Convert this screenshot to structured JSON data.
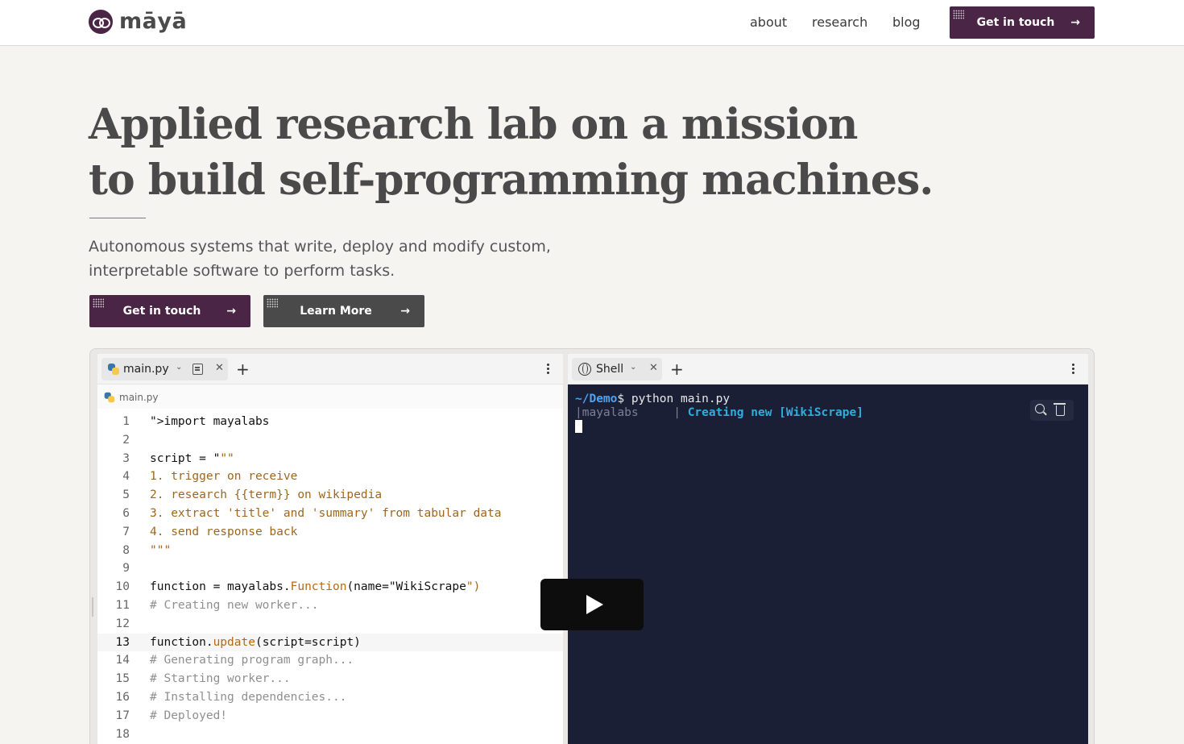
{
  "header": {
    "brand": "māyā",
    "nav": [
      "about",
      "research",
      "blog"
    ],
    "cta_label": "Get in touch"
  },
  "hero": {
    "title_line1": "Applied research lab on a mission",
    "title_line2": "to build self-programming machines.",
    "subtitle_line1": "Autonomous systems that write, deploy and modify custom,",
    "subtitle_line2": "interpretable software to perform tasks.",
    "primary_button": "Get in touch",
    "secondary_button": "Learn More"
  },
  "editor": {
    "tab_label": "main.py",
    "breadcrumb": "main.py",
    "lines": [
      {
        "n": "1",
        "text": "import mayalabs"
      },
      {
        "n": "2",
        "text": ""
      },
      {
        "n": "3",
        "text": "script = \"\"\""
      },
      {
        "n": "4",
        "text": "1. trigger on receive"
      },
      {
        "n": "5",
        "text": "2. research {{term}} on wikipedia"
      },
      {
        "n": "6",
        "text": "3. extract 'title' and 'summary' from tabular data"
      },
      {
        "n": "7",
        "text": "4. send response back"
      },
      {
        "n": "8",
        "text": "\"\"\""
      },
      {
        "n": "9",
        "text": ""
      },
      {
        "n": "10",
        "text": "function = mayalabs.Function(name=\"WikiScrape\")"
      },
      {
        "n": "11",
        "text": "# Creating new worker..."
      },
      {
        "n": "12",
        "text": ""
      },
      {
        "n": "13",
        "text": "function.update(script=script)"
      },
      {
        "n": "14",
        "text": "# Generating program graph..."
      },
      {
        "n": "15",
        "text": "# Starting worker..."
      },
      {
        "n": "16",
        "text": "# Installing dependencies..."
      },
      {
        "n": "17",
        "text": "# Deployed!"
      },
      {
        "n": "18",
        "text": ""
      }
    ]
  },
  "shell": {
    "tab_label": "Shell",
    "prompt": "~/Demo",
    "command": "$ python main.py",
    "log_source": "|mayalabs     | ",
    "log_message": "Creating new [WikiScrape]"
  },
  "colors": {
    "brand_purple": "#4b2545",
    "dark_button": "#4a4a4a",
    "terminal_bg": "#1a1f36",
    "terminal_accent": "#2eaedc"
  },
  "icons": {
    "logo": "maya-logo-icon",
    "arrow": "arrow-right-icon",
    "play": "play-icon"
  }
}
